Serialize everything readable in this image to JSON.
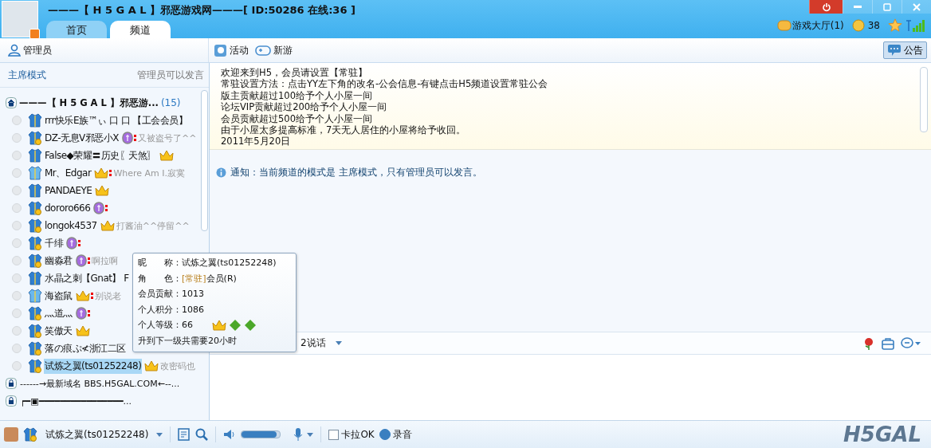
{
  "header": {
    "title": "———【 H 5 G A L 】邪恶游戏网———[ ID:50286 在线:36 ]"
  },
  "tabs": [
    {
      "label": "首页",
      "selected": false
    },
    {
      "label": "频道",
      "selected": true
    }
  ],
  "status": {
    "game_hall": "游戏大厅(1)",
    "coins": "38"
  },
  "toolbar": {
    "admin": "管理员",
    "links": [
      "活动",
      "新游"
    ],
    "announce": {
      "label": "公告",
      "selected": true
    }
  },
  "mode": {
    "name": "主席模式",
    "rule": "管理员可以发言"
  },
  "tree": {
    "label": "———【 H 5 G A L 】邪恶游...",
    "count": "(15)",
    "children": [
      {
        "name": "rrr快乐E族™ぃ 口 口 【工会会员】",
        "kind": "plain",
        "mic": false,
        "selected": false
      },
      {
        "name": "DZ-无息V邪恶小X",
        "kind": "medal",
        "badge": {
          "kind": "shield"
        },
        "mic": true,
        "status": "又被盗号了^^",
        "selected": false
      },
      {
        "name": "False◆荣耀〓历史〖天煞〗",
        "kind": "plain",
        "badge": {
          "kind": "crown"
        },
        "mic": false,
        "selected": false
      },
      {
        "name": "Mr、Edgar",
        "kind": "light",
        "badge": {
          "kind": "crown"
        },
        "mic": true,
        "status": "Where Am I.寂寞",
        "selected": false
      },
      {
        "name": "PANDAEYE",
        "kind": "plain",
        "badge": {
          "kind": "crown"
        },
        "mic": false,
        "selected": false
      },
      {
        "name": "dororo666",
        "kind": "medal",
        "badge": {
          "kind": "shield"
        },
        "mic": true,
        "selected": false
      },
      {
        "name": "longok4537",
        "kind": "medal",
        "badge": {
          "kind": "crown"
        },
        "mic": false,
        "status": "打酱油^^停留^^",
        "selected": false
      },
      {
        "name": "千绯",
        "kind": "medal",
        "badge": {
          "kind": "shield"
        },
        "mic": true,
        "selected": false
      },
      {
        "name": "幽淼君",
        "kind": "medal",
        "badge": {
          "kind": "shield"
        },
        "mic": true,
        "status": "啊拉啊",
        "selected": false
      },
      {
        "name": "水晶之刺【Gnat】 F",
        "kind": "plain",
        "mic": false,
        "selected": false
      },
      {
        "name": "海盗鼠",
        "kind": "light",
        "badge": {
          "kind": "crown"
        },
        "mic": true,
        "status": "别说老",
        "selected": false
      },
      {
        "name": "灬道灬",
        "kind": "medal",
        "badge": {
          "kind": "shield"
        },
        "mic": true,
        "selected": false
      },
      {
        "name": "笑傲天",
        "kind": "medal",
        "badge": {
          "kind": "crown"
        },
        "mic": false,
        "selected": false
      },
      {
        "name": "落の痕ぷ≮浙江二区",
        "kind": "medal",
        "mic": false,
        "selected": false
      },
      {
        "name": "试炼之翼(ts01252248)",
        "kind": "medal",
        "badge": {
          "kind": "crown"
        },
        "mic": false,
        "status": "改密码也",
        "selected": true
      }
    ]
  },
  "sub_channels": [
    "------→最新域名 BBS.H5GAL.COM←--...",
    "┍━▣━━━━━━━━━━━━━━━━..."
  ],
  "bulletin": [
    "欢迎来到H5，会员请设置【常驻】",
    "常驻设置方法：点击YY左下角的改名-公会信息-有键点击H5频道设置常驻公会",
    "版主贡献超过100给予个人小屋一间",
    "论坛VIP贡献超过200给予个人小屋一间",
    "会员贡献超过500给予个人小屋一间",
    "由于小屋太多提高标准，7天无人居住的小屋将给予收回。",
    "2011年5月20日"
  ],
  "notice": "通知：当前频道的模式是 主席模式，只有管理员可以发言。",
  "tooltip": {
    "nickname_label": "昵　　称：",
    "nickname": "试炼之翼(ts01252248)",
    "role_label": "角　　色：",
    "role_tag": "[常驻]",
    "role": "会员(R)",
    "contribution": "会员贡献：1013",
    "points": "个人积分：1086",
    "level": "个人等级：66",
    "next": "升到下一级共需要20小时"
  },
  "input_bar": {
    "speak": "2说话"
  },
  "bottom": {
    "user": "试炼之翼(ts01252248)",
    "volume": {
      "level": 0.9
    },
    "karaoke": {
      "label": "卡拉OK",
      "checked": false
    },
    "record": {
      "label": "录音",
      "on": true
    },
    "logo": "H5GAL"
  }
}
